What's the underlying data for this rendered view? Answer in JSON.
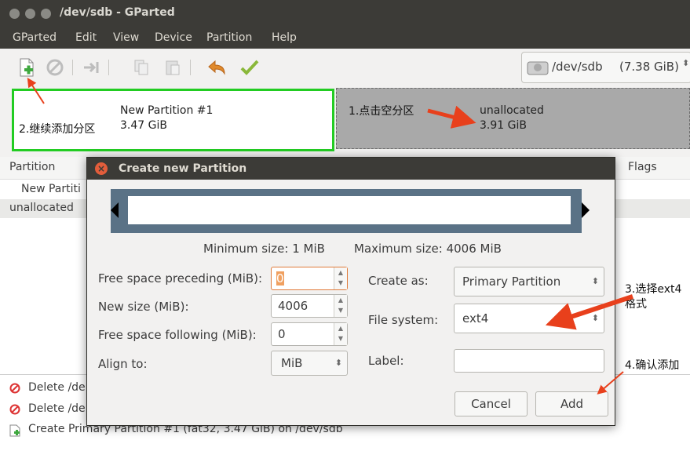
{
  "window": {
    "title": "/dev/sdb - GParted"
  },
  "menu": [
    "GParted",
    "Edit",
    "View",
    "Device",
    "Partition",
    "Help"
  ],
  "toolbar": {
    "icons": [
      "new-partition-icon",
      "delete-icon",
      "resize-move-icon",
      "copy-icon",
      "paste-icon",
      "undo-icon",
      "apply-icon"
    ],
    "device": "/dev/sdb",
    "device_size": "(7.38 GiB)"
  },
  "graphic": {
    "new_partition": {
      "name": "New Partition #1",
      "size": "3.47 GiB"
    },
    "unallocated": {
      "name": "unallocated",
      "size": "3.91 GiB"
    }
  },
  "list": {
    "headers": {
      "partition": "Partition",
      "flags": "Flags"
    },
    "rows": [
      "New Partiti",
      "unallocated"
    ]
  },
  "pending": [
    {
      "icon": "delete-icon",
      "text": "Delete /de"
    },
    {
      "icon": "delete-icon",
      "text": "Delete /de"
    },
    {
      "icon": "new-partition-icon",
      "text": "Create Primary Partition #1 (fat32, 3.47 GiB) on /dev/sdb"
    }
  ],
  "dialog": {
    "title": "Create new Partition",
    "min_size": "Minimum size: 1 MiB",
    "max_size": "Maximum size: 4006 MiB",
    "fields": {
      "free_preceding": {
        "label": "Free space preceding (MiB):",
        "value": "0"
      },
      "new_size": {
        "label": "New size (MiB):",
        "value": "4006"
      },
      "free_following": {
        "label": "Free space following (MiB):",
        "value": "0"
      },
      "align_to": {
        "label": "Align to:",
        "value": "MiB"
      },
      "create_as": {
        "label": "Create as:",
        "value": "Primary Partition"
      },
      "file_system": {
        "label": "File system:",
        "value": "ext4"
      },
      "label": {
        "label": "Label:",
        "value": ""
      }
    },
    "buttons": {
      "cancel": "Cancel",
      "add": "Add"
    }
  },
  "annotations": {
    "a1": "1.点击空分区",
    "a2": "2.继续添加分区",
    "a3_line1": "3.选择ext4",
    "a3_line2": "格式",
    "a4": "4.确认添加"
  },
  "colors": {
    "highlight_box": "#22cc22",
    "arrow": "#e8401c",
    "dialog_title": "#3c3b37"
  }
}
